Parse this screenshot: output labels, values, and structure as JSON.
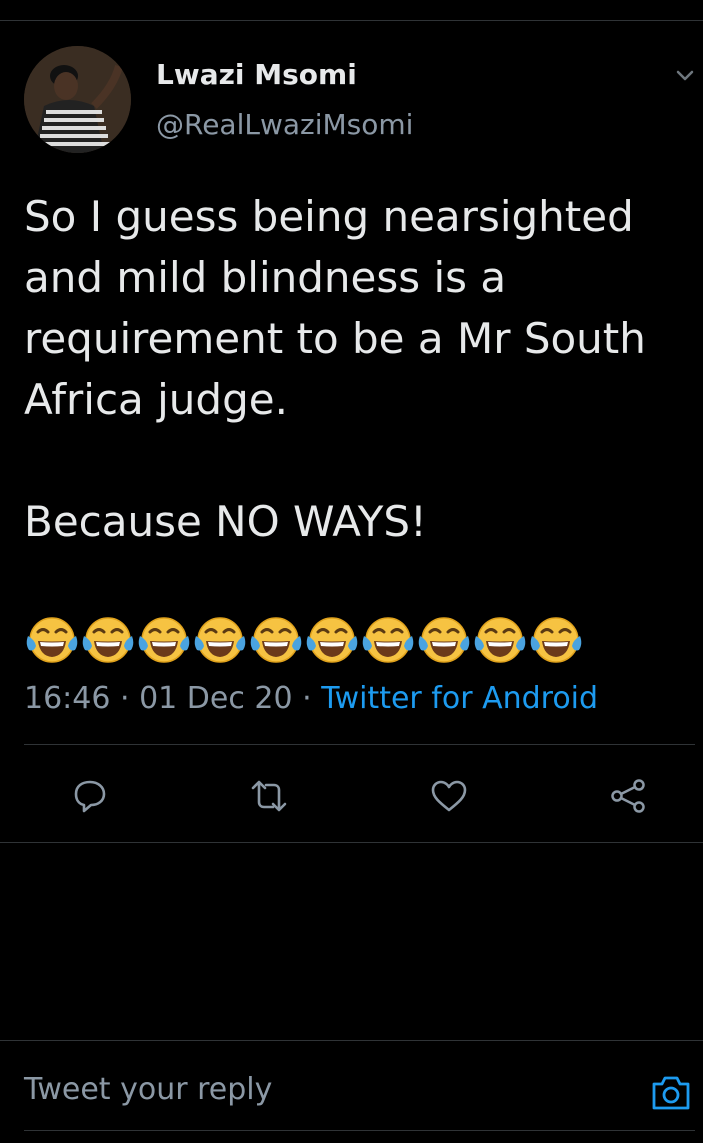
{
  "tweet": {
    "author": {
      "display_name": "Lwazi Msomi",
      "handle": "@RealLwaziMsomi"
    },
    "text_lines": [
      "So I guess being nearsighted",
      "and mild blindness is a",
      "requirement to be a Mr South",
      "Africa judge."
    ],
    "text_line_2": "Because NO WAYS!",
    "emojis": [
      "😂",
      "😂",
      "😂",
      "😂",
      "😂",
      "😂",
      "😂",
      "😂",
      "😂",
      "😂"
    ],
    "time": "16:46",
    "date": "01 Dec 20",
    "source": "Twitter for Android"
  },
  "actions": [
    {
      "name": "reply-icon"
    },
    {
      "name": "retweet-icon"
    },
    {
      "name": "like-icon"
    },
    {
      "name": "share-icon"
    }
  ],
  "reply": {
    "placeholder": "Tweet your reply"
  },
  "colors": {
    "background": "#000000",
    "accent": "#1d9bf0",
    "secondary_text": "#8b98a5",
    "divider": "#2f3336"
  }
}
